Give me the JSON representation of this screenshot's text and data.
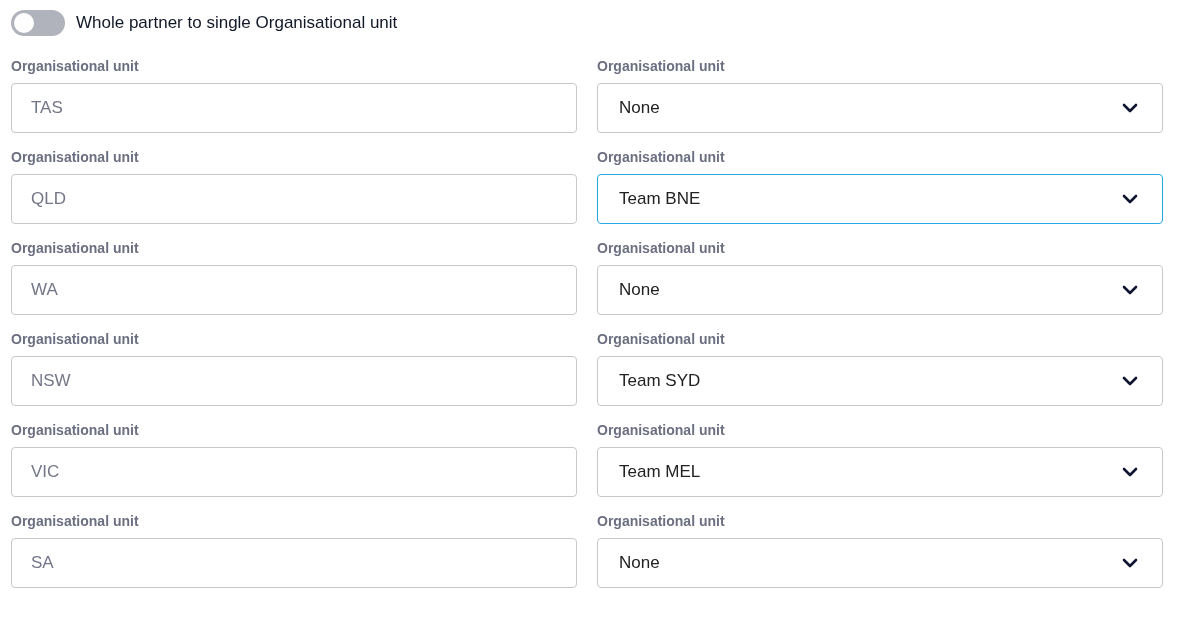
{
  "toggle": {
    "label": "Whole partner to single Organisational unit",
    "on": false
  },
  "rows": [
    {
      "left": {
        "label": "Organisational unit",
        "value": "TAS",
        "disabled": true
      },
      "right": {
        "label": "Organisational unit",
        "value": "None",
        "focused": false
      }
    },
    {
      "left": {
        "label": "Organisational unit",
        "value": "QLD",
        "disabled": true
      },
      "right": {
        "label": "Organisational unit",
        "value": "Team BNE",
        "focused": true
      }
    },
    {
      "left": {
        "label": "Organisational unit",
        "value": "WA",
        "disabled": true
      },
      "right": {
        "label": "Organisational unit",
        "value": "None",
        "focused": false
      }
    },
    {
      "left": {
        "label": "Organisational unit",
        "value": "NSW",
        "disabled": true
      },
      "right": {
        "label": "Organisational unit",
        "value": "Team SYD",
        "focused": false
      }
    },
    {
      "left": {
        "label": "Organisational unit",
        "value": "VIC",
        "disabled": true
      },
      "right": {
        "label": "Organisational unit",
        "value": "Team MEL",
        "focused": false
      }
    },
    {
      "left": {
        "label": "Organisational unit",
        "value": "SA",
        "disabled": true
      },
      "right": {
        "label": "Organisational unit",
        "value": "None",
        "focused": false
      }
    }
  ]
}
